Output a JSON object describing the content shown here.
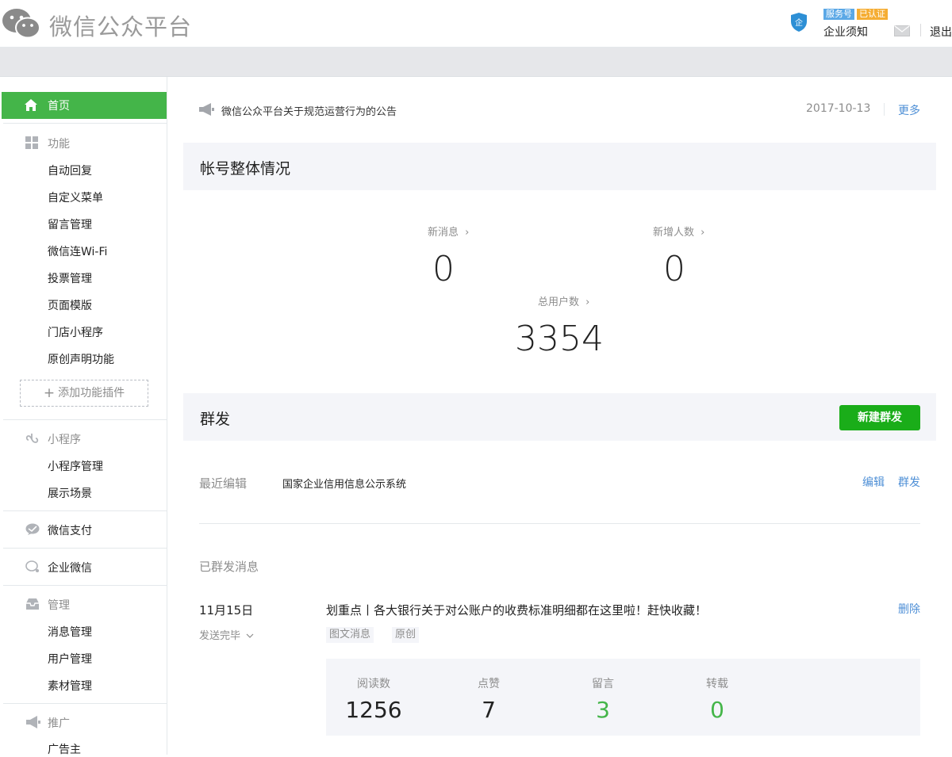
{
  "header": {
    "logo_title": "微信公众平台",
    "tag_service": "服务号",
    "tag_verified": "已认证",
    "account_name": "企业须知",
    "logout": "退出",
    "colors": {
      "tag_service": "#5ba8e6",
      "tag_verified": "#f5ad33"
    }
  },
  "sidebar": {
    "home": "首页",
    "func_group": "功能",
    "func_items": [
      "自动回复",
      "自定义菜单",
      "留言管理",
      "微信连Wi-Fi",
      "投票管理",
      "页面模版",
      "门店小程序",
      "原创声明功能"
    ],
    "add_plugin": "添加功能插件",
    "mini_group": "小程序",
    "mini_items": [
      "小程序管理",
      "展示场景"
    ],
    "pay": "微信支付",
    "work_wechat": "企业微信",
    "manage_group": "管理",
    "manage_items": [
      "消息管理",
      "用户管理",
      "素材管理"
    ],
    "promo_group": "推广",
    "promo_items": [
      "广告主"
    ]
  },
  "announcement": {
    "text": "微信公众平台关于规范运营行为的公告",
    "date": "2017-10-13",
    "more": "更多"
  },
  "overview": {
    "title": "帐号整体情况",
    "new_msg_label": "新消息",
    "new_msg_value": "0",
    "new_users_label": "新增人数",
    "new_users_value": "0",
    "total_users_label": "总用户数",
    "total_users_value": "3354"
  },
  "mass": {
    "title": "群发",
    "new_button": "新建群发",
    "recent_label": "最近编辑",
    "recent_title": "国家企业信用信息公示系统",
    "edit": "编辑",
    "send": "群发",
    "sent_label": "已群发消息",
    "sent_item": {
      "date": "11月15日",
      "status": "发送完毕",
      "title": "划重点丨各大银行关于对公账户的收费标准明细都在这里啦！赶快收藏！",
      "delete": "删除",
      "tags": [
        "图文消息",
        "原创"
      ],
      "stats": [
        {
          "label": "阅读数",
          "value": "1256"
        },
        {
          "label": "点赞",
          "value": "7"
        },
        {
          "label": "留言",
          "value": "3"
        },
        {
          "label": "转载",
          "value": "0"
        }
      ]
    }
  }
}
